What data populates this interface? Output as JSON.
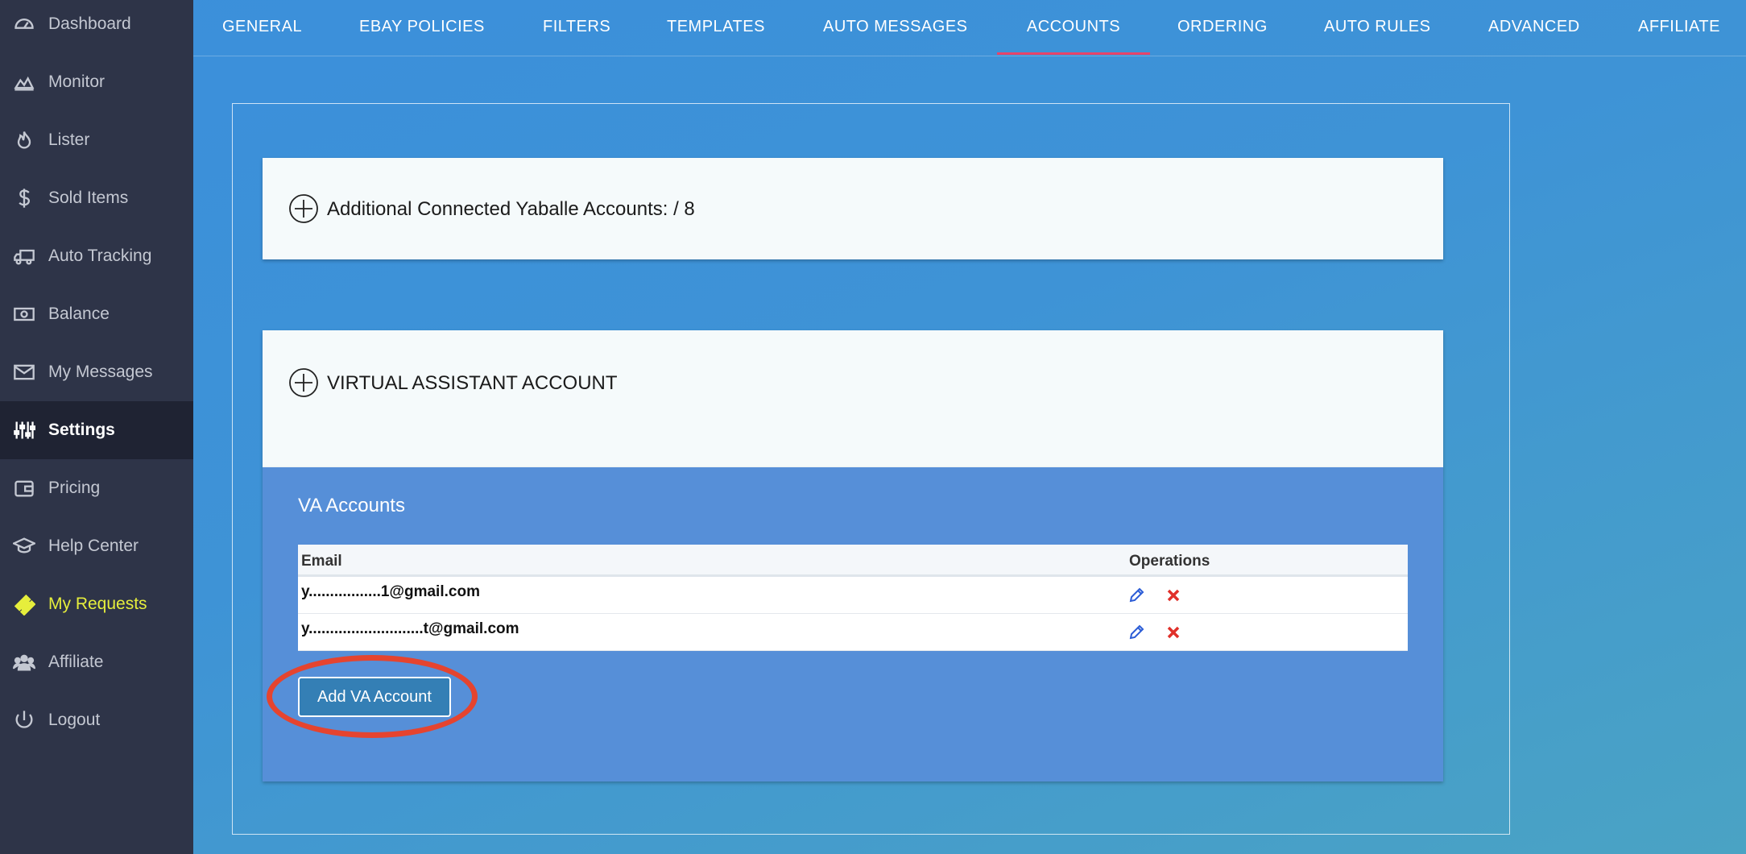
{
  "sidebar": {
    "items": [
      {
        "label": "Dashboard",
        "icon": "dashboard-icon"
      },
      {
        "label": "Monitor",
        "icon": "chart-icon"
      },
      {
        "label": "Lister",
        "icon": "fire-icon"
      },
      {
        "label": "Sold Items",
        "icon": "dollar-icon"
      },
      {
        "label": "Auto Tracking",
        "icon": "truck-icon"
      },
      {
        "label": "Balance",
        "icon": "money-icon"
      },
      {
        "label": "My Messages",
        "icon": "envelope-icon"
      },
      {
        "label": "Settings",
        "icon": "sliders-icon",
        "active": true
      },
      {
        "label": "Pricing",
        "icon": "wallet-icon"
      },
      {
        "label": "Help Center",
        "icon": "graduation-cap-icon"
      },
      {
        "label": "My Requests",
        "icon": "ticket-icon",
        "highlight_color": "#e6ee3c"
      },
      {
        "label": "Affiliate",
        "icon": "users-icon"
      },
      {
        "label": "Logout",
        "icon": "power-icon"
      }
    ]
  },
  "tabs": [
    {
      "label": "GENERAL"
    },
    {
      "label": "EBAY POLICIES"
    },
    {
      "label": "FILTERS"
    },
    {
      "label": "TEMPLATES"
    },
    {
      "label": "AUTO MESSAGES"
    },
    {
      "label": "ACCOUNTS",
      "active": true
    },
    {
      "label": "ORDERING"
    },
    {
      "label": "AUTO RULES"
    },
    {
      "label": "ADVANCED"
    },
    {
      "label": "AFFILIATE"
    }
  ],
  "connected_accounts": {
    "title": "Additional Connected Yaballe Accounts: / 8"
  },
  "va_section": {
    "title": "VIRTUAL ASSISTANT ACCOUNT",
    "subtitle": "VA Accounts",
    "columns": {
      "email": "Email",
      "operations": "Operations"
    },
    "rows": [
      {
        "email": "y.................1@gmail.com"
      },
      {
        "email": "y...........................t@gmail.com"
      }
    ],
    "add_button": "Add VA Account"
  },
  "colors": {
    "sidebar_bg": "#2e3448",
    "active_tab_underline": "#e7446a",
    "annotation_circle": "#e5442f",
    "edit_icon": "#2b5cd6",
    "delete_icon": "#e0302a"
  }
}
